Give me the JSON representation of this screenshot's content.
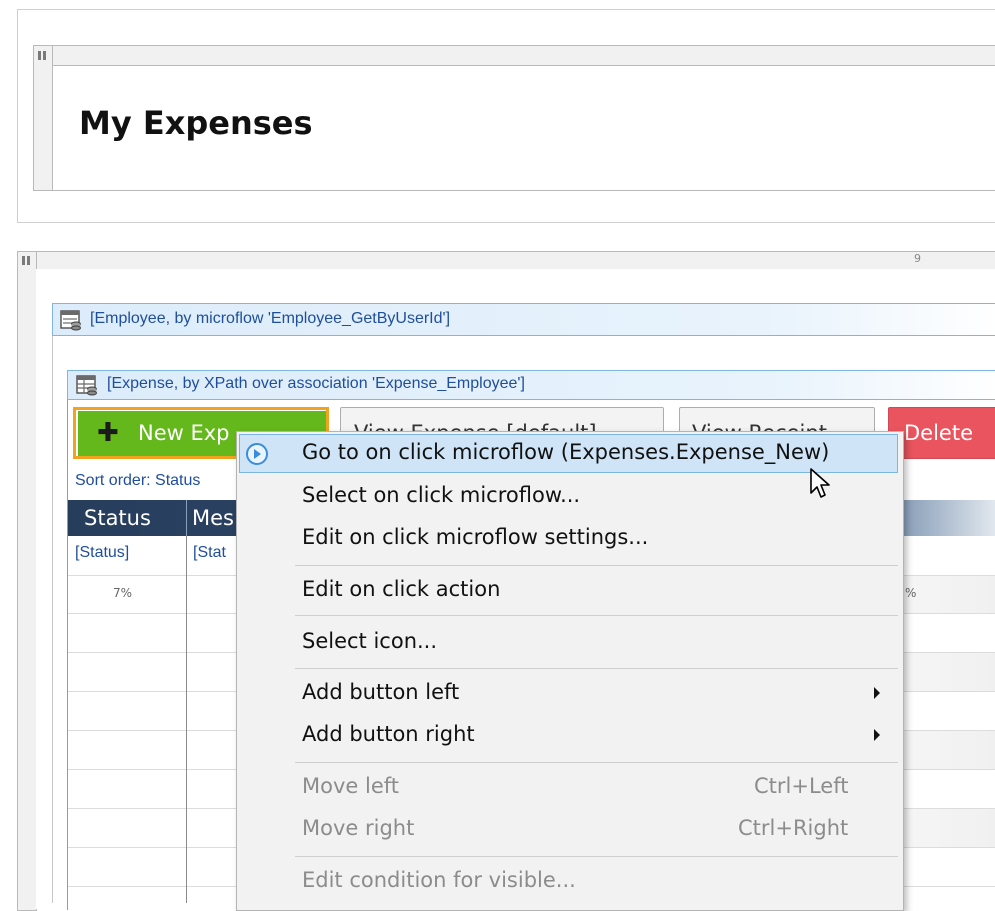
{
  "header": {
    "title": "My Expenses"
  },
  "layout": {
    "column_number": "9"
  },
  "employee_dataview": {
    "label": "[Employee, by microflow 'Employee_GetByUserId']"
  },
  "expense_datagrid": {
    "label": "[Expense, by XPath over association 'Expense_Employee']",
    "buttons": {
      "new_label": "New Exp",
      "view_label": "View Expense [default]",
      "receipt_label": "View Receipt",
      "delete_label": "Delete"
    },
    "sort_order": "Sort order: Status",
    "columns": [
      {
        "header": "Status",
        "cell": "[Status]",
        "width": "7%"
      },
      {
        "header": "Mes",
        "cell": "[Stat",
        "width": ""
      }
    ],
    "right_width": "%"
  },
  "context_menu": {
    "items": [
      {
        "label": "Go to on click microflow (Expenses.Expense_New)",
        "icon": "play-circle-icon"
      },
      {
        "label": "Select on click microflow..."
      },
      {
        "label": "Edit on click microflow settings..."
      },
      {
        "label": "Edit on click action"
      },
      {
        "label": "Select icon..."
      },
      {
        "label": "Add button left"
      },
      {
        "label": "Add button right"
      },
      {
        "label": "Move left",
        "shortcut": "Ctrl+Left"
      },
      {
        "label": "Move right",
        "shortcut": "Ctrl+Right"
      },
      {
        "label": "Edit condition for visible..."
      }
    ]
  },
  "colors": {
    "accent_green": "#65b81c",
    "focus_orange": "#f1a21f",
    "danger_red": "#e9545e",
    "link_blue": "#1f4e9a",
    "header_navy": "#273d5c"
  }
}
